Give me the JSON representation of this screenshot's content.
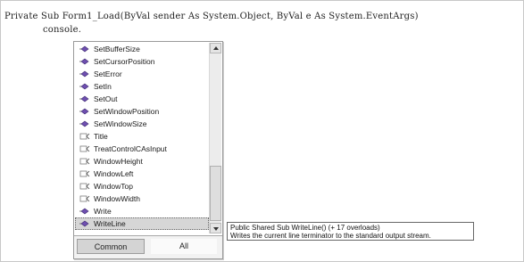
{
  "editor": {
    "line1": "Private Sub Form1_Load(ByVal sender As System.Object, ByVal e As System.EventArgs)",
    "line2": "console."
  },
  "intellisense": {
    "items": [
      {
        "label": "SetBufferSize",
        "icon": "method-icon"
      },
      {
        "label": "SetCursorPosition",
        "icon": "method-icon"
      },
      {
        "label": "SetError",
        "icon": "method-icon"
      },
      {
        "label": "SetIn",
        "icon": "method-icon"
      },
      {
        "label": "SetOut",
        "icon": "method-icon"
      },
      {
        "label": "SetWindowPosition",
        "icon": "method-icon"
      },
      {
        "label": "SetWindowSize",
        "icon": "method-icon"
      },
      {
        "label": "Title",
        "icon": "property-icon"
      },
      {
        "label": "TreatControlCAsInput",
        "icon": "property-icon"
      },
      {
        "label": "WindowHeight",
        "icon": "property-icon"
      },
      {
        "label": "WindowLeft",
        "icon": "property-icon"
      },
      {
        "label": "WindowTop",
        "icon": "property-icon"
      },
      {
        "label": "WindowWidth",
        "icon": "property-icon"
      },
      {
        "label": "Write",
        "icon": "method-icon"
      },
      {
        "label": "WriteLine",
        "icon": "method-icon",
        "selected": true
      }
    ],
    "tabs": {
      "common": "Common",
      "all": "All"
    }
  },
  "tooltip": {
    "signature": "Public Shared Sub WriteLine() (+ 17 overloads)",
    "description": "Writes the current line terminator to the standard output stream."
  },
  "colors": {
    "method_icon": "#6f4fb0",
    "property_icon": "#7a7a7a",
    "selection": "#d6d6d6"
  }
}
